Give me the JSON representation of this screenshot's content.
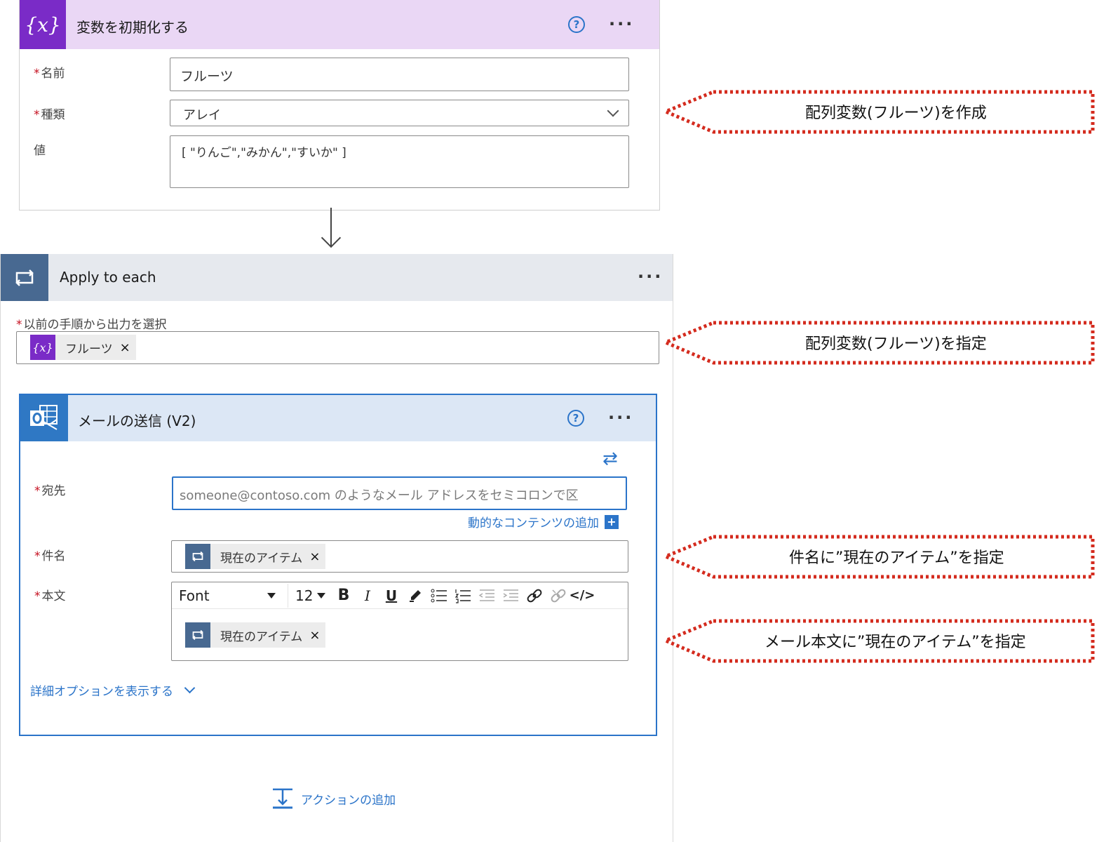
{
  "init_variable": {
    "icon": "variable-icon",
    "icon_glyph": "{x}",
    "title": "変数を初期化する",
    "help_glyph": "?",
    "more_glyph": "···",
    "fields": {
      "name": {
        "label": "名前",
        "value": "フルーツ"
      },
      "type": {
        "label": "種類",
        "value": "アレイ"
      },
      "value": {
        "label": "値",
        "value": "[ \"りんご\",\"みかん\",\"すいか\" ]"
      }
    }
  },
  "apply_to_each": {
    "icon": "loop-icon",
    "title": "Apply to each",
    "more_glyph": "···",
    "output_label": "以前の手順から出力を選択",
    "token": {
      "icon_glyph": "{x}",
      "label": "フルーツ",
      "remove_glyph": "×"
    }
  },
  "send_email": {
    "icon": "outlook-icon",
    "title": "メールの送信 (V2)",
    "help_glyph": "?",
    "more_glyph": "···",
    "swap_glyph": "⇄",
    "to": {
      "label": "宛先",
      "placeholder": "someone@contoso.com のようなメール アドレスをセミコロンで区",
      "dynamic_link": "動的なコンテンツの追加",
      "plus_glyph": "+"
    },
    "subject": {
      "label": "件名",
      "token": {
        "label": "現在のアイテム",
        "remove_glyph": "×"
      }
    },
    "body": {
      "label": "本文",
      "font": "Font",
      "font_size": "12",
      "toolbar_glyphs": {
        "bold": "B",
        "italic": "I",
        "underline": "U",
        "code": "</>"
      },
      "token": {
        "label": "現在のアイテム",
        "remove_glyph": "×"
      }
    },
    "advanced_link": "詳細オプションを表示する"
  },
  "add_action": {
    "label": "アクションの追加"
  },
  "required_marker": "*",
  "annotations": [
    "配列変数(フルーツ)を作成",
    "配列変数(フルーツ)を指定",
    "件名に”現在のアイテム”を指定",
    "メール本文に”現在のアイテム”を指定"
  ],
  "colors": {
    "variable_purple": "#7a2bc7",
    "variable_header": "#ead7f5",
    "loop_header": "#e6e9ee",
    "loop_icon": "#486991",
    "email_header": "#dce7f5",
    "accent_blue": "#2b74c9",
    "required_red": "#c50f1f",
    "annotation_red": "#d42b1e"
  }
}
